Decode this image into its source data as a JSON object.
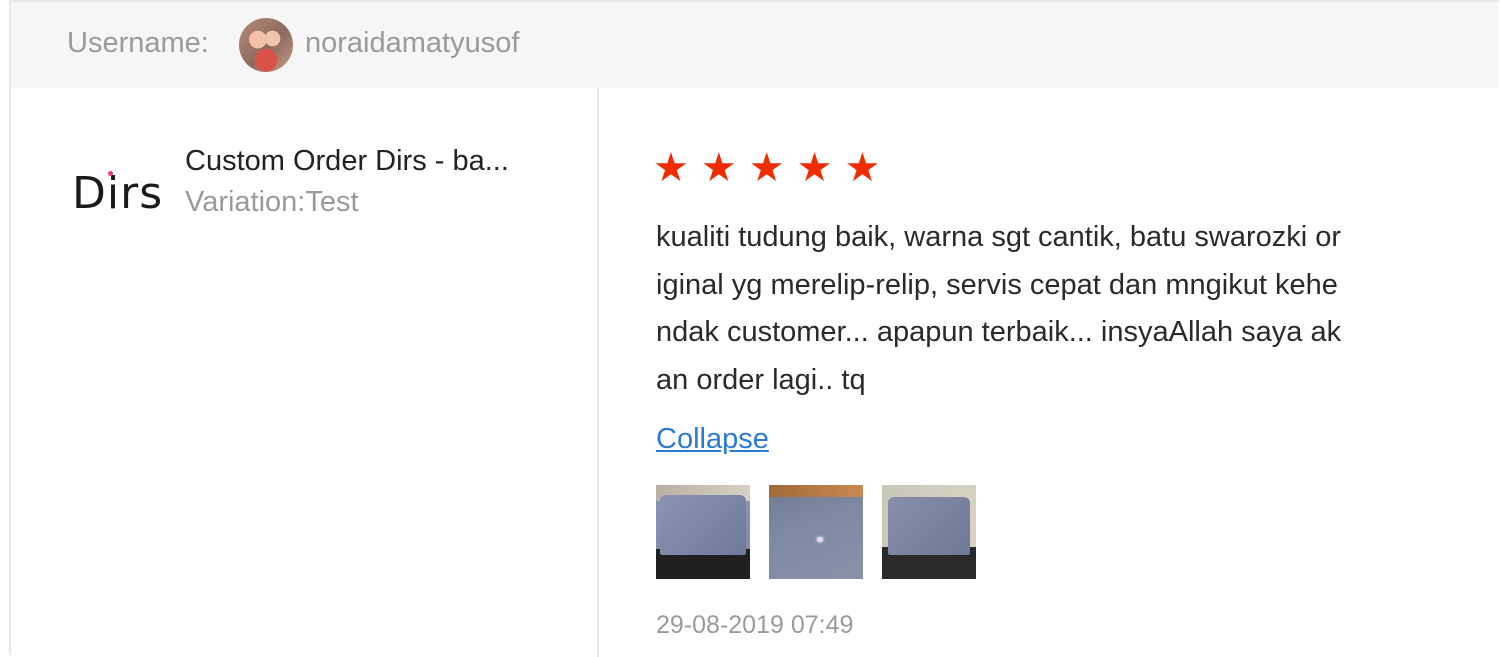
{
  "header": {
    "username_label": "Username:",
    "username": "noraidamatyusof"
  },
  "product": {
    "logo_text": "Dirs",
    "name": "Custom Order Dirs - ba...",
    "variation": "Variation:Test"
  },
  "review": {
    "rating": 5,
    "rating_max": 5,
    "star_color": "#ee2c00",
    "text_lines": [
      "kualiti tudung baik, warna sgt cantik, batu swarozki or",
      "iginal yg merelip-relip, servis cepat dan mngikut kehe",
      "ndak customer... apapun terbaik... insyaAllah saya ak",
      "an order lagi.. tq"
    ],
    "collapse_label": "Collapse",
    "link_color": "#2b7bd6",
    "timestamp": "29-08-2019 07:49"
  }
}
